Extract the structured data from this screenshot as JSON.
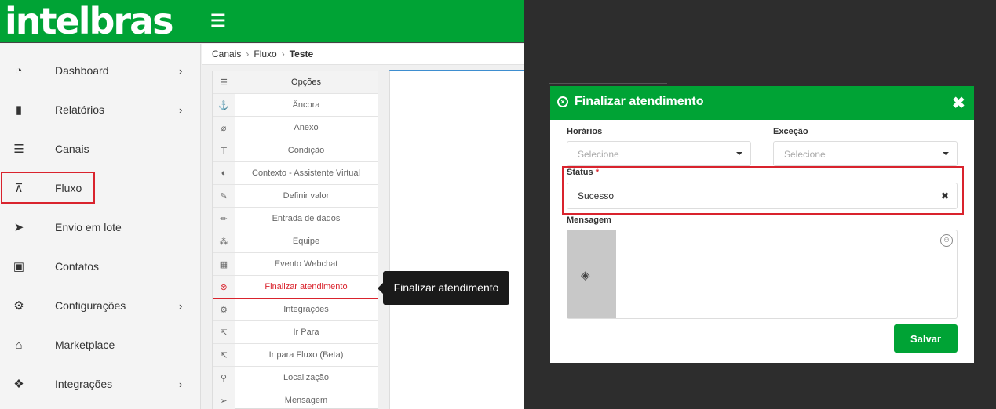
{
  "brand": {
    "logo_text": "intelbras",
    "accent": "#00a335",
    "highlight": "#d9232d"
  },
  "header": {
    "menu_icon": "hamburger-icon"
  },
  "sidebar": {
    "items": [
      {
        "label": "Dashboard",
        "icon": "dashboard-icon",
        "has_submenu": true
      },
      {
        "label": "Relatórios",
        "icon": "book-icon",
        "has_submenu": true
      },
      {
        "label": "Canais",
        "icon": "list-icon",
        "has_submenu": false
      },
      {
        "label": "Fluxo",
        "icon": "sitemap-icon",
        "has_submenu": false,
        "highlighted": true
      },
      {
        "label": "Envio em lote",
        "icon": "paper-plane-icon",
        "has_submenu": false
      },
      {
        "label": "Contatos",
        "icon": "address-book-icon",
        "has_submenu": false
      },
      {
        "label": "Configurações",
        "icon": "cogs-icon",
        "has_submenu": true
      },
      {
        "label": "Marketplace",
        "icon": "store-icon",
        "has_submenu": false
      },
      {
        "label": "Integrações",
        "icon": "cubes-icon",
        "has_submenu": true
      }
    ]
  },
  "breadcrumb": {
    "items": [
      "Canais",
      "Fluxo"
    ],
    "current": "Teste"
  },
  "options_panel": {
    "header": "Opções",
    "items": [
      {
        "label": "Âncora",
        "icon": "anchor-icon"
      },
      {
        "label": "Anexo",
        "icon": "paperclip-icon"
      },
      {
        "label": "Condição",
        "icon": "signs-icon"
      },
      {
        "label": "Contexto - Assistente Virtual",
        "icon": "brain-icon"
      },
      {
        "label": "Definir valor",
        "icon": "edit-icon"
      },
      {
        "label": "Entrada de dados",
        "icon": "pencil-icon"
      },
      {
        "label": "Equipe",
        "icon": "users-icon"
      },
      {
        "label": "Evento Webchat",
        "icon": "calendar-icon"
      },
      {
        "label": "Finalizar atendimento",
        "icon": "times-circle-icon",
        "active": true
      },
      {
        "label": "Integrações",
        "icon": "cogs-icon"
      },
      {
        "label": "Ir Para",
        "icon": "external-link-icon"
      },
      {
        "label": "Ir para Fluxo (Beta)",
        "icon": "external-link-icon"
      },
      {
        "label": "Localização",
        "icon": "map-marker-icon"
      },
      {
        "label": "Mensagem",
        "icon": "paper-plane-icon"
      }
    ]
  },
  "tooltip": {
    "text": "Finalizar atendimento"
  },
  "modal": {
    "title": "Finalizar atendimento",
    "horarios_label": "Horários",
    "horarios_placeholder": "Selecione",
    "excecao_label": "Exceção",
    "excecao_placeholder": "Selecione",
    "status_label": "Status",
    "status_required": "*",
    "status_value": "Sucesso",
    "mensagem_label": "Mensagem",
    "save_label": "Salvar"
  }
}
